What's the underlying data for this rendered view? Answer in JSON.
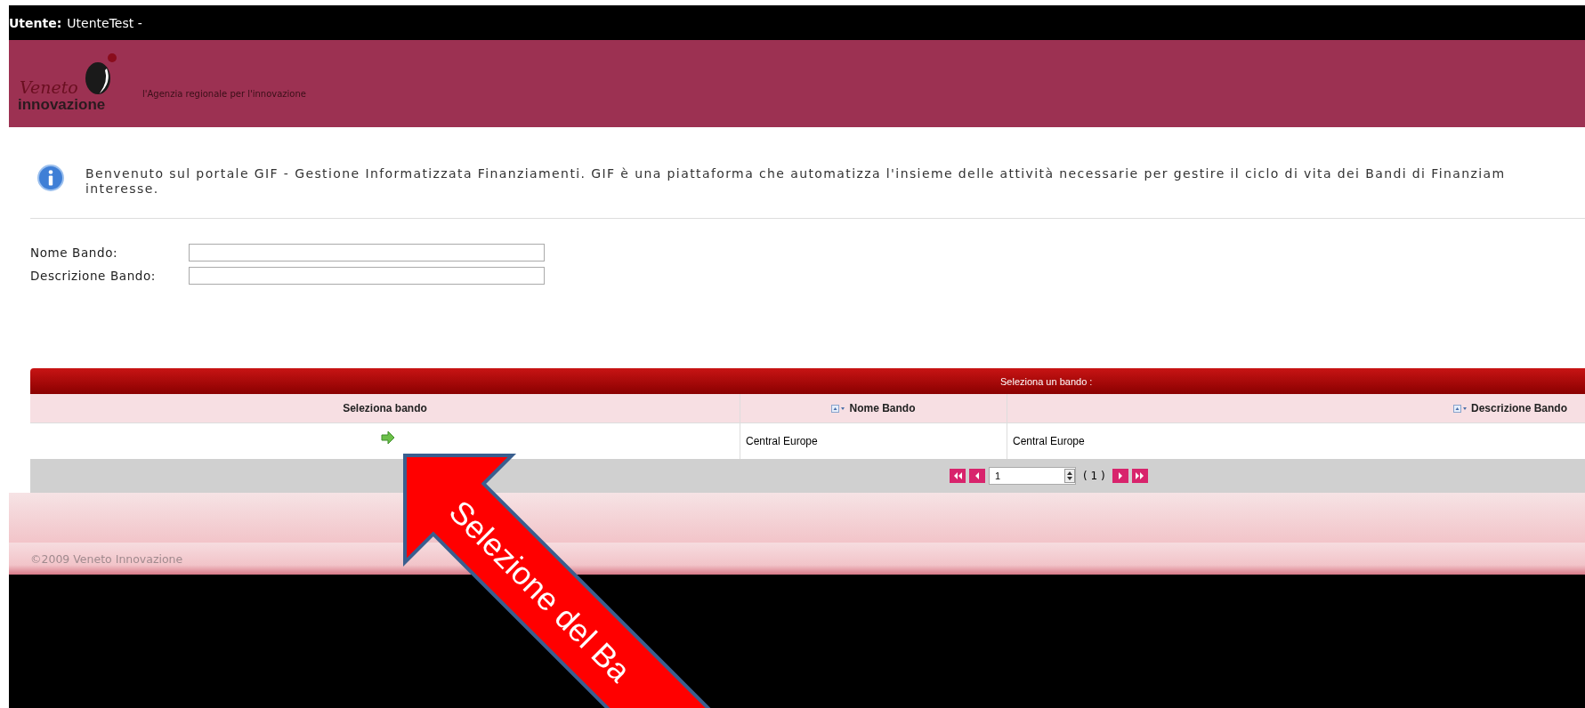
{
  "user_bar": {
    "label": "Utente:",
    "name": "UtenteTest -"
  },
  "header": {
    "logo_script": "Veneto",
    "logo_word": "innovazione",
    "tagline": "l'Agenzia regionale per l'innovazione"
  },
  "info": {
    "lines": [
      "Benvenuto sul portale GIF - Gestione Informatizzata Finanziamenti. GIF è una piattaforma che automatizza l'insieme delle attività necessarie per gestire il ciclo di vita dei Bandi di Finanziam",
      "interesse."
    ]
  },
  "filters": [
    {
      "label": "Nome Bando:"
    },
    {
      "label": "Descrizione Bando:"
    }
  ],
  "table": {
    "title": "Seleziona un bando :",
    "columns": [
      {
        "label": "Seleziona bando",
        "sortable": false
      },
      {
        "label": "Nome Bando",
        "sortable": true
      },
      {
        "label": "Descrizione Bando",
        "sortable": true
      }
    ],
    "rows": [
      {
        "nome": "Central Europe",
        "descrizione": "Central Europe"
      }
    ],
    "pager": {
      "page": "1",
      "total": "( 1 )"
    }
  },
  "footer": {
    "text": "©2009 Veneto Innovazione"
  },
  "annotation": {
    "text": "Selezione del Ba"
  }
}
